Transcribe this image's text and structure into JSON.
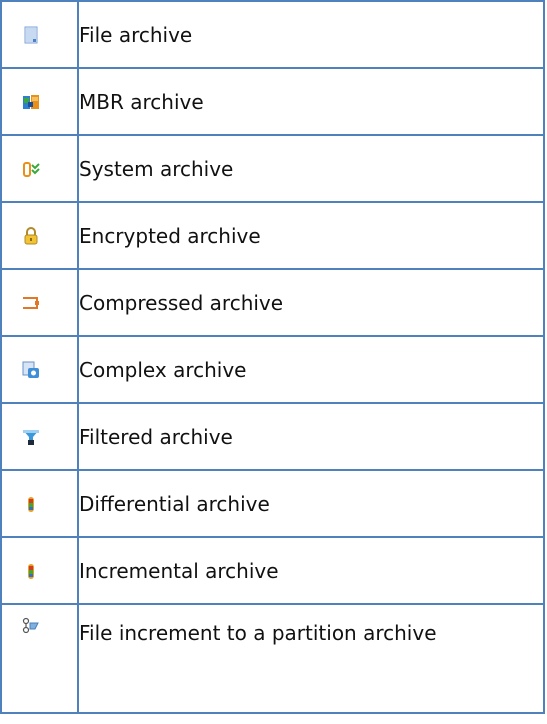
{
  "rows": [
    {
      "icon": "file-archive-icon",
      "label": "File archive"
    },
    {
      "icon": "mbr-archive-icon",
      "label": "MBR archive"
    },
    {
      "icon": "system-archive-icon",
      "label": "System archive"
    },
    {
      "icon": "encrypted-archive-icon",
      "label": "Encrypted archive"
    },
    {
      "icon": "compressed-archive-icon",
      "label": "Compressed archive"
    },
    {
      "icon": "complex-archive-icon",
      "label": "Complex archive"
    },
    {
      "icon": "filtered-archive-icon",
      "label": "Filtered archive"
    },
    {
      "icon": "differential-archive-icon",
      "label": "Differential archive"
    },
    {
      "icon": "incremental-archive-icon",
      "label": "Incremental archive"
    },
    {
      "icon": "file-increment-partition-icon",
      "label": "File increment to a partition archive"
    }
  ],
  "colors": {
    "border": "#4f81bd"
  }
}
